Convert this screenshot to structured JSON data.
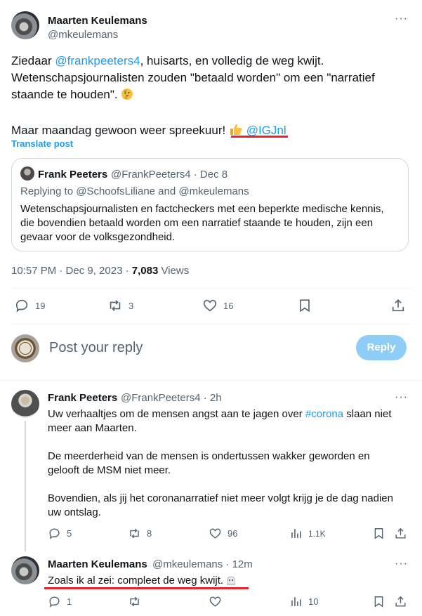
{
  "main_post": {
    "author_name": "Maarten Keulemans",
    "author_handle": "@mkeulemans",
    "text_intro": "Ziedaar ",
    "mention": "@frankpeeters4",
    "text_line1_rest": ", huisarts, en volledig de weg kwijt.",
    "text_line2": "Wetenschapsjournalisten zouden \"betaald worden\" om een \"narratief",
    "text_line3": "staande te houden\".",
    "text_line4": "Maar maandag gewoon weer spreekuur!",
    "mention2": "@IGJnl",
    "translate": "Translate post",
    "timestamp": "10:57 PM · Dec 9, 2023 · ",
    "views_count": "7,083",
    "views_label": " Views",
    "stats": {
      "replies": "19",
      "reposts": "3",
      "likes": "16"
    }
  },
  "quoted": {
    "author_name": "Frank Peeters",
    "author_handle": "@FrankPeeters4 · Dec 8",
    "replying": "Replying to @SchoofsLiliane and @mkeulemans",
    "line1": "Wetenschapsjournalisten en factcheckers met een beperkte medische kennis,",
    "line2": "die bovendien betaald worden om een narratief staande te houden, zijn een",
    "line3": "gevaar voor de volksgezondheid."
  },
  "reply_box": {
    "placeholder": "Post your reply",
    "button": "Reply"
  },
  "reply1": {
    "author_name": "Frank Peeters",
    "meta": "@FrankPeeters4 · 2h",
    "p1_a": "Uw verhaaltjes om de mensen angst aan te jagen over ",
    "hashtag": "#corona",
    "p1_b": " slaan niet",
    "p1_c": "meer aan Maarten.",
    "p2_a": "De meerderheid van de mensen is ondertussen wakker geworden en",
    "p2_b": "gelooft de MSM niet meer.",
    "p3_a": "Bovendien, als jij het coronanarratief niet meer volgt krijg je de dag nadien",
    "p3_b": "uw ontslag.",
    "stats": {
      "replies": "5",
      "reposts": "8",
      "likes": "96",
      "views": "1.1K"
    }
  },
  "reply2": {
    "author_name": "Maarten Keulemans",
    "meta": "@mkeulemans · 12m",
    "text": "Zoals ik al zei: compleet de weg kwijt.",
    "stats": {
      "replies": "1",
      "views": "10"
    }
  },
  "colors": {
    "accent": "#1d9bf0",
    "muted": "#536471",
    "annotation": "#e8232b",
    "reply_button": "#8ecdf7"
  }
}
